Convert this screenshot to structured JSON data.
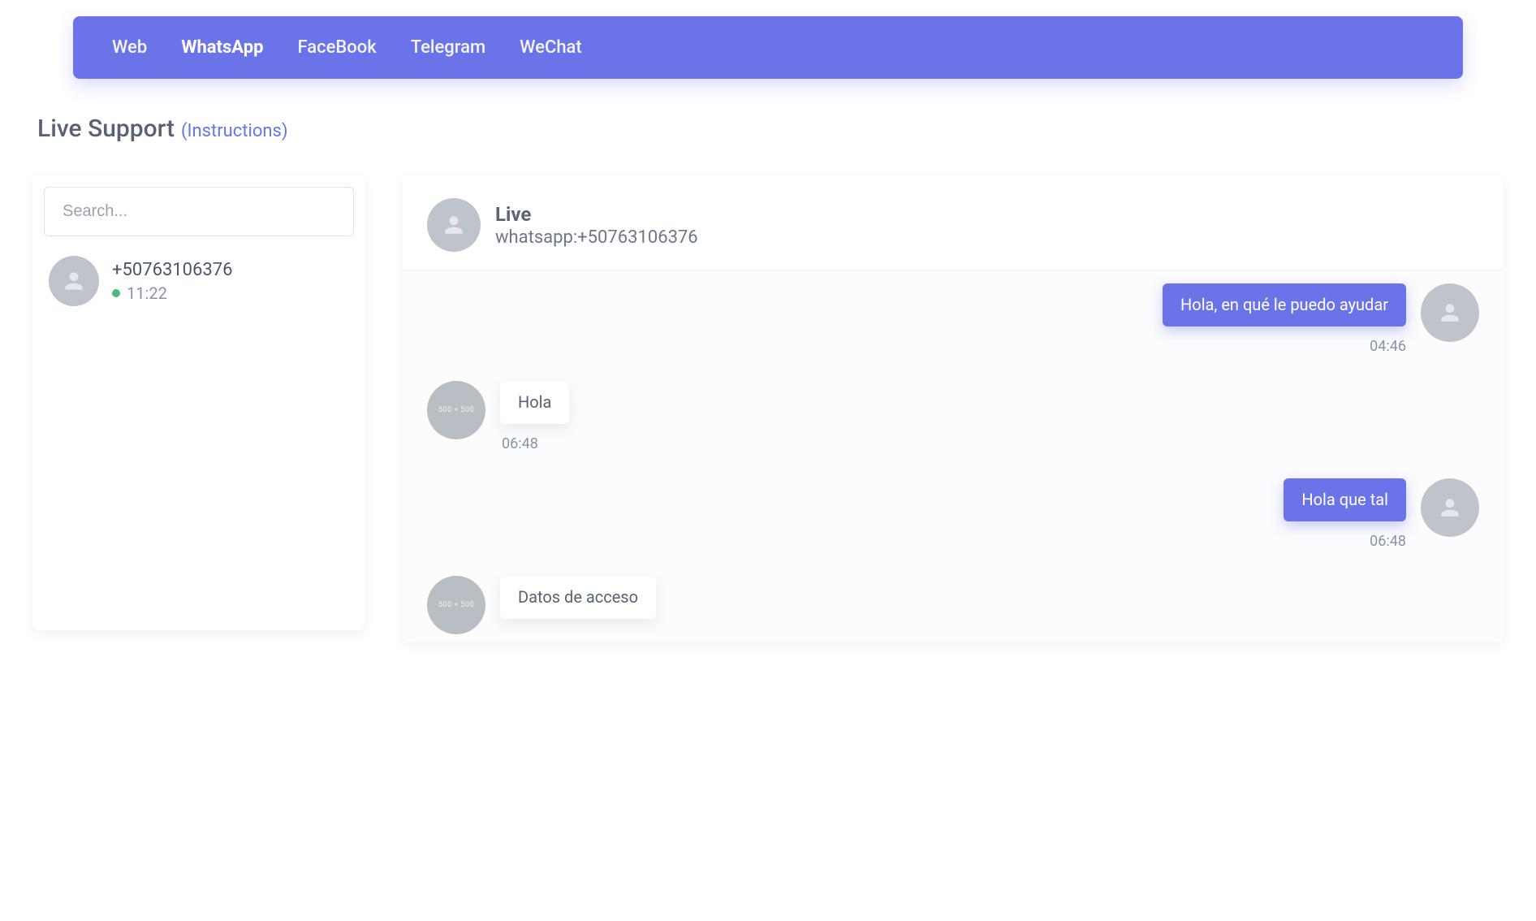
{
  "tabs": {
    "items": [
      {
        "label": "Web"
      },
      {
        "label": "WhatsApp"
      },
      {
        "label": "FaceBook"
      },
      {
        "label": "Telegram"
      },
      {
        "label": "WeChat"
      }
    ],
    "active_index": 1
  },
  "page_title": "Live Support",
  "instructions_link": "(Instructions)",
  "search": {
    "placeholder": "Search..."
  },
  "contacts": [
    {
      "name": "+50763106376",
      "time": "11:22",
      "online": true
    }
  ],
  "conversation": {
    "title": "Live",
    "subtitle": "whatsapp:+50763106376",
    "messages": [
      {
        "side": "out",
        "text": "Hola, en qué le puedo ayudar",
        "time": "04:46",
        "avatar": "silhouette"
      },
      {
        "side": "in",
        "text": "Hola",
        "time": "06:48",
        "avatar": "placeholder",
        "avatar_text": "500 × 500"
      },
      {
        "side": "out",
        "text": "Hola que tal",
        "time": "06:48",
        "avatar": "silhouette"
      },
      {
        "side": "in",
        "text": "Datos de acceso",
        "time": "",
        "avatar": "placeholder",
        "avatar_text": "500 × 500"
      }
    ]
  }
}
